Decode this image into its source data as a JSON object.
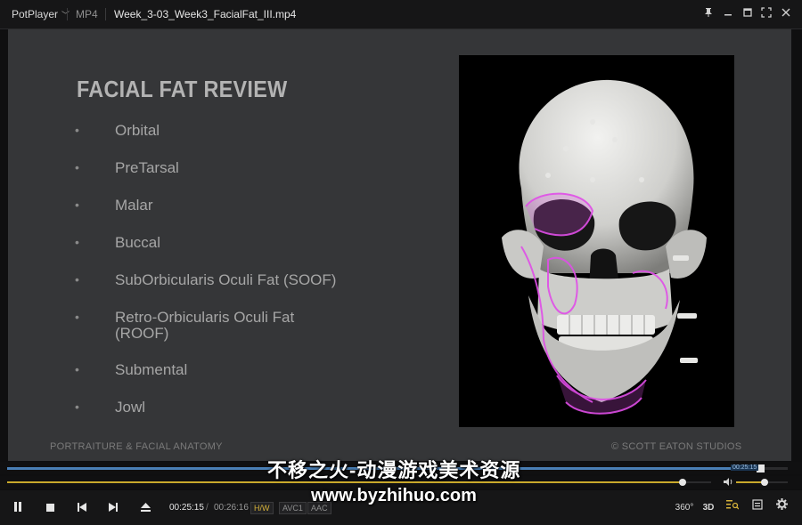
{
  "titlebar": {
    "app_name": "PotPlayer",
    "format": "MP4",
    "filename": "Week_3-03_Week3_FacialFat_III.mp4"
  },
  "slide": {
    "title": "FACIAL FAT REVIEW",
    "bullets": [
      "Orbital",
      "PreTarsal",
      "Malar",
      "Buccal",
      "SubOrbicularis Oculi Fat (SOOF)",
      "Retro-Orbicularis Oculi Fat (ROOF)",
      "Submental",
      "Jowl"
    ],
    "footer_left": "PORTRAITURE & FACIAL ANATOMY",
    "footer_right": "© SCOTT EATON STUDIOS"
  },
  "watermark": {
    "line1": "不移之火-动漫游戏美术资源",
    "line2": "www.byzhihuo.com"
  },
  "seek": {
    "progress": 0.965,
    "time_badge": "00:25:15"
  },
  "secondary_bar": {
    "progress": 0.96
  },
  "volume": {
    "level": 0.55
  },
  "controls": {
    "current_time": "00:25:15",
    "separator": "/",
    "total_time": "00:26:16",
    "badges": [
      "H/W",
      "AVC1",
      "AAC"
    ],
    "badge_colors": [
      "#d6b23a",
      "#8f8f8f",
      "#8f8f8f"
    ],
    "right_labels": {
      "threesixty": "360°",
      "threed": "3D"
    }
  },
  "colors": {
    "accent_blue": "#4a7fb5",
    "accent_yellow": "#c9a92b",
    "fat_overlay": "#e04ee8"
  }
}
